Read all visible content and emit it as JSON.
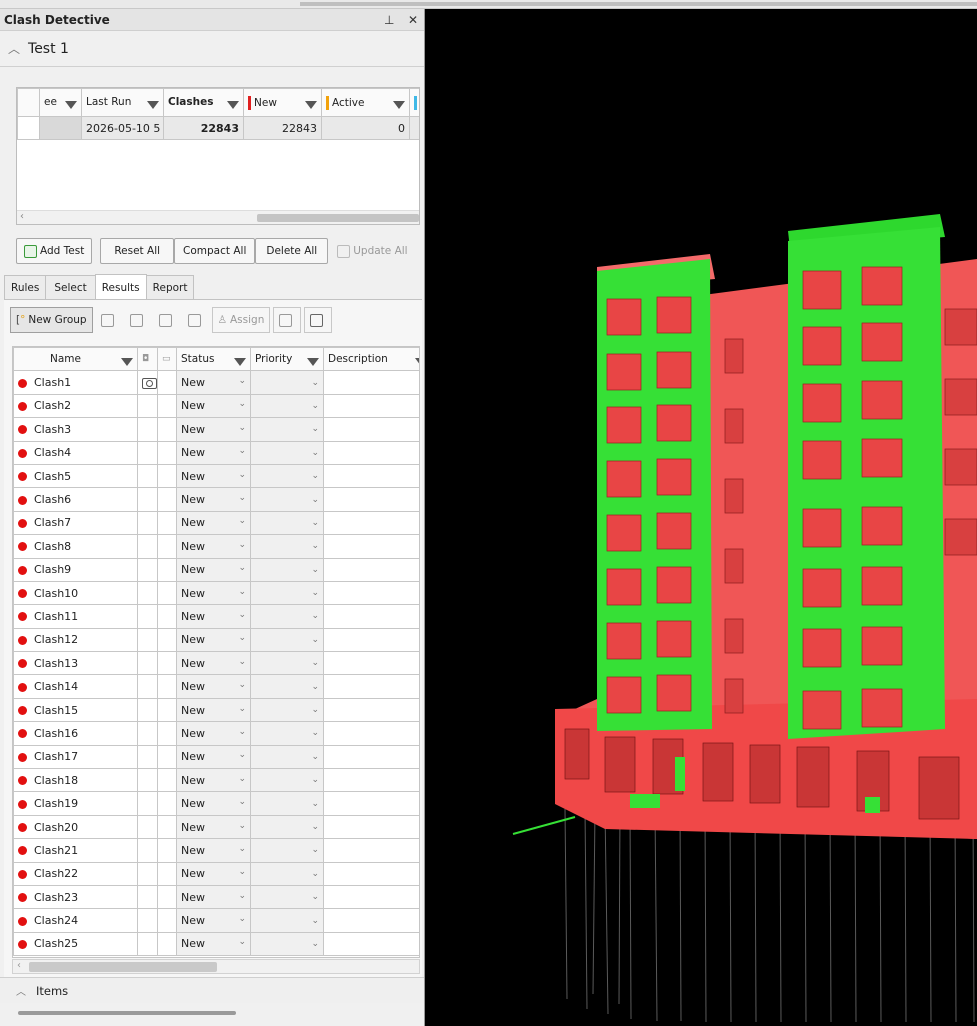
{
  "panel": {
    "title": "Clash Detective",
    "pin_glyph": "⊥",
    "close_glyph": "✕"
  },
  "test": {
    "name": "Test 1"
  },
  "tests_table": {
    "headers": [
      "ee",
      "Last Run",
      "Clashes",
      "New",
      "Active"
    ],
    "row": {
      "last_run": "2026-05-10 5",
      "clashes": "22843",
      "new": "22843",
      "active": "0"
    },
    "colors": {
      "new": "#e02020",
      "active": "#f2a20c",
      "approved": "#3fb8e6"
    }
  },
  "test_buttons": {
    "add": "Add Test",
    "reset": "Reset All",
    "compact": "Compact All",
    "delete": "Delete All",
    "update": "Update All"
  },
  "tabs": [
    "Rules",
    "Select",
    "Results",
    "Report"
  ],
  "results_toolbar": {
    "new_group": "New Group",
    "assign": "Assign"
  },
  "results_headers": {
    "name": "Name",
    "status": "Status",
    "priority": "Priority",
    "description": "Description"
  },
  "clashes": [
    {
      "name": "Clash1",
      "status": "New"
    },
    {
      "name": "Clash2",
      "status": "New"
    },
    {
      "name": "Clash3",
      "status": "New"
    },
    {
      "name": "Clash4",
      "status": "New"
    },
    {
      "name": "Clash5",
      "status": "New"
    },
    {
      "name": "Clash6",
      "status": "New"
    },
    {
      "name": "Clash7",
      "status": "New"
    },
    {
      "name": "Clash8",
      "status": "New"
    },
    {
      "name": "Clash9",
      "status": "New"
    },
    {
      "name": "Clash10",
      "status": "New"
    },
    {
      "name": "Clash11",
      "status": "New"
    },
    {
      "name": "Clash12",
      "status": "New"
    },
    {
      "name": "Clash13",
      "status": "New"
    },
    {
      "name": "Clash14",
      "status": "New"
    },
    {
      "name": "Clash15",
      "status": "New"
    },
    {
      "name": "Clash16",
      "status": "New"
    },
    {
      "name": "Clash17",
      "status": "New"
    },
    {
      "name": "Clash18",
      "status": "New"
    },
    {
      "name": "Clash19",
      "status": "New"
    },
    {
      "name": "Clash20",
      "status": "New"
    },
    {
      "name": "Clash21",
      "status": "New"
    },
    {
      "name": "Clash22",
      "status": "New"
    },
    {
      "name": "Clash23",
      "status": "New"
    },
    {
      "name": "Clash24",
      "status": "New"
    },
    {
      "name": "Clash25",
      "status": "New"
    }
  ],
  "items_section": {
    "label": "Items"
  },
  "viewport": {
    "background": "#000000",
    "clash_color": "#f04848",
    "green_color": "#36e036"
  }
}
